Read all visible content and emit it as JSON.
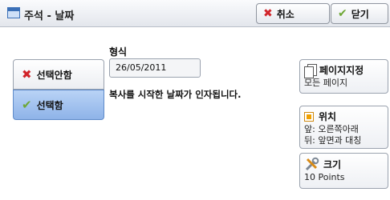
{
  "window": {
    "title": "주석 - 날짜"
  },
  "toolbar": {
    "cancel_label": "취소",
    "close_label": "닫기"
  },
  "options": {
    "off_label": "선택안함",
    "on_label": "선택함",
    "selected": "on"
  },
  "format": {
    "label": "형식",
    "date_value": "26/05/2011"
  },
  "description": "복사를 시작한 날짜가 인자됩니다.",
  "cards": {
    "page_spec": {
      "title": "페이지지정",
      "subtitle": "모든 페이지"
    },
    "position": {
      "title": "위치",
      "line1": "앞: 오른쪽아래",
      "line2": "뒤: 앞면과 대칭"
    },
    "size": {
      "title": "크기",
      "subtitle": "10 Points"
    }
  },
  "icons": {
    "title": "window-icon",
    "cancel": "x-icon",
    "close": "check-icon",
    "off": "x-icon",
    "on": "check-icon",
    "page_spec": "pages-icon",
    "position": "position-icon",
    "size": "tools-icon"
  },
  "colors": {
    "selected_fill": "#9ebfee",
    "cancel_icon": "#d1242a",
    "check_icon": "#6ea735",
    "position_icon": "#f0a000"
  }
}
